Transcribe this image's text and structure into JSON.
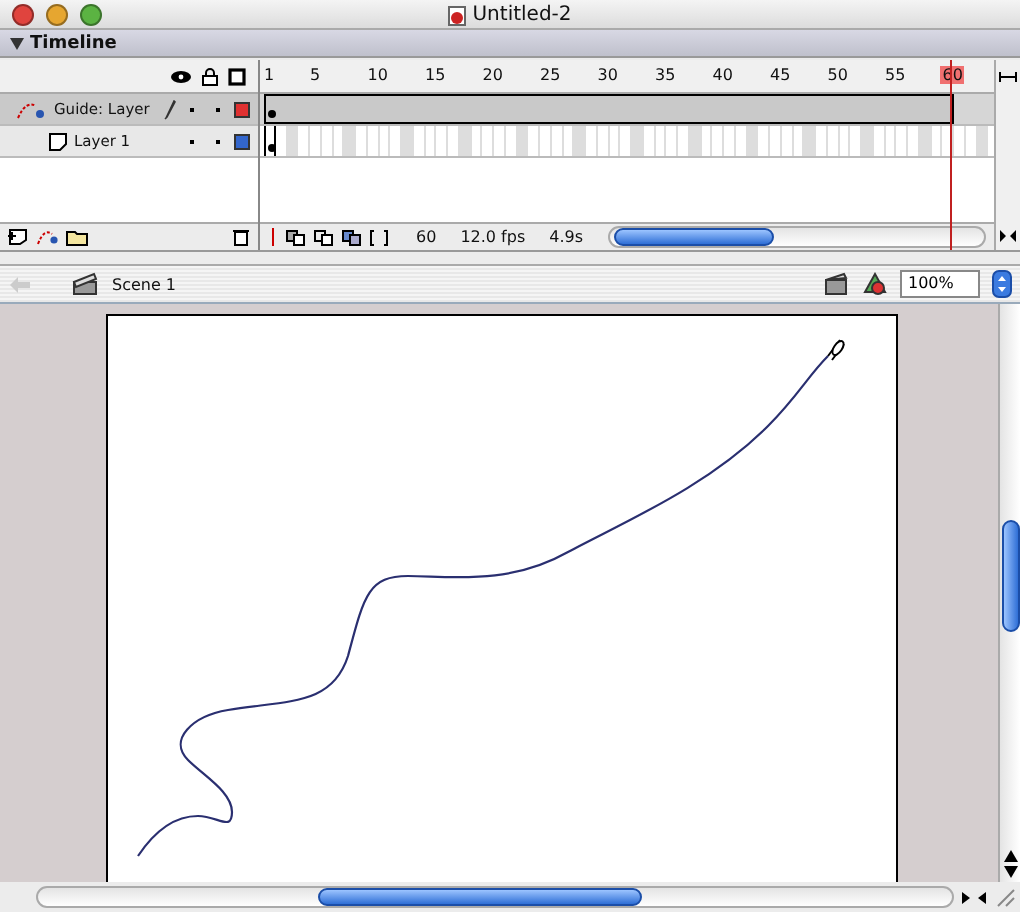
{
  "window": {
    "title": "Untitled-2"
  },
  "timeline": {
    "title": "Timeline",
    "expanded": true,
    "ruler": [
      {
        "label": "1",
        "selected": false
      },
      {
        "label": "5",
        "selected": false
      },
      {
        "label": "10",
        "selected": false
      },
      {
        "label": "15",
        "selected": false
      },
      {
        "label": "20",
        "selected": false
      },
      {
        "label": "25",
        "selected": false
      },
      {
        "label": "30",
        "selected": false
      },
      {
        "label": "35",
        "selected": false
      },
      {
        "label": "40",
        "selected": false
      },
      {
        "label": "45",
        "selected": false
      },
      {
        "label": "50",
        "selected": false
      },
      {
        "label": "55",
        "selected": false
      },
      {
        "label": "60",
        "selected": true
      }
    ],
    "layers": [
      {
        "name": "Guide: Layer",
        "kind": "guide",
        "selected": true,
        "color": "#e03030"
      },
      {
        "name": "Layer 1",
        "kind": "normal",
        "selected": false,
        "color": "#3366cc"
      }
    ],
    "status": {
      "frame": "60",
      "rate": "12.0 fps",
      "time": "4.9s"
    }
  },
  "scene": {
    "name": "Scene 1",
    "zoom": "100%"
  }
}
